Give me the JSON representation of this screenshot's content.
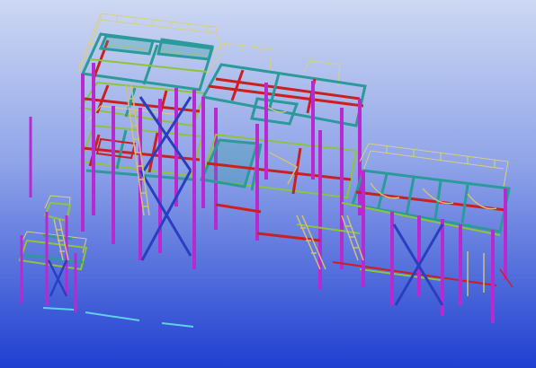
{
  "scene": {
    "subject": "structural-steel-3d-model",
    "colors": {
      "background_top": "#cdd8f2",
      "background_bottom": "#1f3fd0",
      "column": "#b82ad0",
      "girder": "#2a9a9a",
      "beam_red": "#cc2020",
      "brace": "#2a3fc0",
      "railing": "#d8d080",
      "floor_beam": "#8ec43a",
      "stair": "#d0c07a",
      "ground_line": "#5fd0e8"
    }
  }
}
